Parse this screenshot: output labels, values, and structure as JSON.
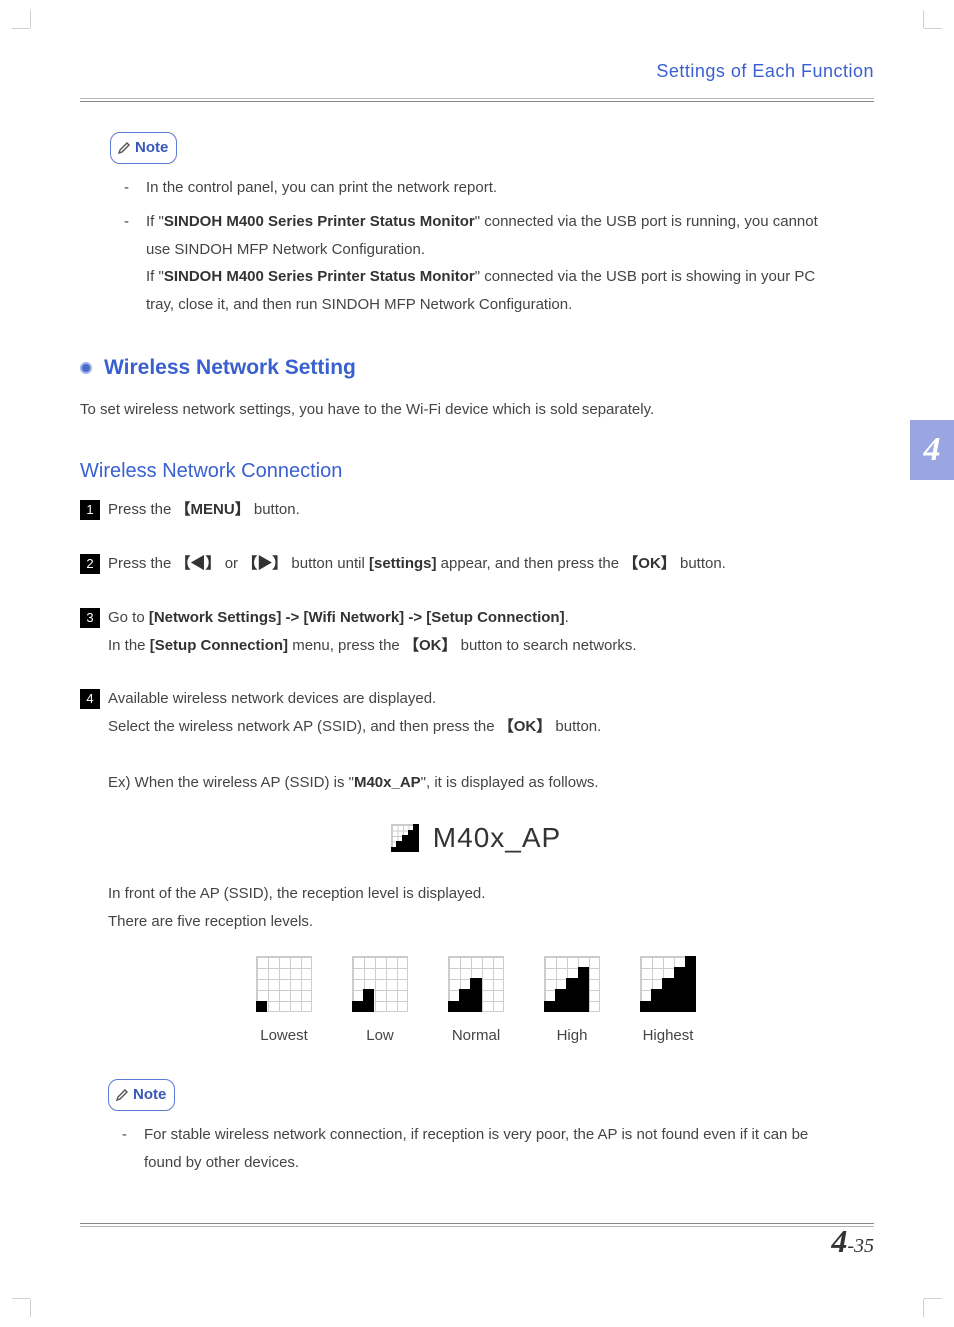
{
  "header": {
    "title": "Settings of Each Function"
  },
  "chapter_tab": "4",
  "note_label": "Note",
  "note1": {
    "items": [
      "In the control panel, you can print the network report.",
      {
        "pre": "If \"",
        "bold1": "SINDOH M400 Series Printer Status Monitor",
        "mid1": "\" connected via the USB port is running, you cannot use SINDOH MFP Network Configuration.",
        "br": true,
        "pre2": "If \"",
        "bold2": "SINDOH M400 Series Printer Status Monitor",
        "post2": "\" connected via the USB port is showing in your PC tray, close it, and then run SINDOH MFP Network Configuration."
      }
    ]
  },
  "section": {
    "heading": "Wireless Network Setting",
    "intro": "To set wireless network settings, you have to the Wi-Fi device which is sold separately."
  },
  "subsection": {
    "heading": "Wireless Network Connection"
  },
  "steps": [
    {
      "text_pre": "Press the ",
      "bold": "【MENU】",
      "text_post": " button."
    },
    {
      "text_pre": "Press the ",
      "bold1": "【◀】",
      "mid1": " or ",
      "bold2": "【▶】",
      "mid2": " button until ",
      "bold3": "[settings]",
      "mid3": " appear, and then press the ",
      "bold4": "【OK】",
      "post": " button."
    },
    {
      "text_pre": "Go to ",
      "bold1": "[Network Settings] -> [Wifi Network] -> [Setup Connection]",
      "post": ".",
      "line2_pre": "In the ",
      "line2_bold": "[Setup Connection]",
      "line2_mid": " menu, press the ",
      "line2_bold2": "【OK】",
      "line2_post": " button to search networks."
    },
    {
      "line1": "Available wireless network devices are displayed.",
      "line2_pre": "Select the wireless network AP (SSID), and then press the ",
      "line2_bold": "【OK】",
      "line2_post": " button.",
      "ex_pre": "Ex) When the wireless AP (SSID) is \"",
      "ex_bold": "M40x_AP",
      "ex_post": "\", it is displayed as follows.",
      "ap_name": "M40x_AP",
      "after1": "In front of the AP (SSID), the reception level is displayed.",
      "after2": "There are five reception levels."
    }
  ],
  "levels": [
    "Lowest",
    "Low",
    "Normal",
    "High",
    "Highest"
  ],
  "note2": {
    "text": "For stable wireless network connection, if reception is very poor, the AP is not found even if it can be found by other devices."
  },
  "footer": {
    "chapter": "4",
    "dash": "-",
    "page": "35"
  }
}
